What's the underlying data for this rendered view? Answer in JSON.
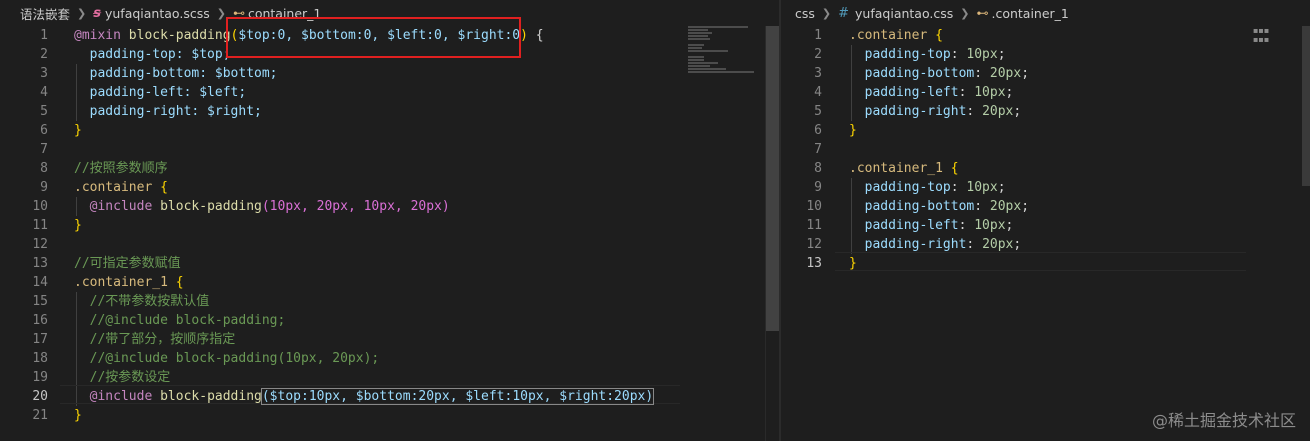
{
  "left": {
    "breadcrumb": {
      "folder": "语法嵌套",
      "file": "yufaqiantao.scss",
      "symbol": "container_1"
    },
    "lines": [
      "1",
      "2",
      "3",
      "4",
      "5",
      "6",
      "7",
      "8",
      "9",
      "10",
      "11",
      "12",
      "13",
      "14",
      "15",
      "16",
      "17",
      "18",
      "19",
      "20",
      "21"
    ],
    "code": {
      "l1_kw": "@mixin",
      "l1_fn": " block-padding",
      "l1_open": "(",
      "l1_args": "$top:0, $bottom:0, $left:0, $right:0",
      "l1_close": ")",
      "l1_brace": " {",
      "l2": "padding-top: $top;",
      "l3": "padding-bottom: $bottom;",
      "l4": "padding-left: $left;",
      "l5": "padding-right: $right;",
      "l6": "}",
      "l8": "//按照参数顺序",
      "l9_sel": ".container",
      "l9_brace": " {",
      "l10_kw": "@include",
      "l10_fn": " block-padding",
      "l10_args": "(10px, 20px, 10px, 20px)",
      "l11": "}",
      "l13": "//可指定参数赋值",
      "l14_sel": ".container_1",
      "l14_brace": " {",
      "l15": "//不带参数按默认值",
      "l16": "//@include block-padding;",
      "l17": "//带了部分，按顺序指定",
      "l18": "//@include block-padding(10px, 20px);",
      "l19": "//按参数设定",
      "l20_kw": "@include",
      "l20_fn": " block-padding",
      "l20_args": "($top:10px, $bottom:20px, $left:10px, $right:20px)",
      "l21": "}"
    }
  },
  "right": {
    "breadcrumb": {
      "folder": "css",
      "file": "yufaqiantao.css",
      "symbol": ".container_1"
    },
    "lines": [
      "1",
      "2",
      "3",
      "4",
      "5",
      "6",
      "7",
      "8",
      "9",
      "10",
      "11",
      "12",
      "13"
    ],
    "code": {
      "r1": ".container",
      "r1b": " {",
      "r2p": "padding-top",
      "r2v": "10px",
      "r3p": "padding-bottom",
      "r3v": "20px",
      "r4p": "padding-left",
      "r4v": "10px",
      "r5p": "padding-right",
      "r5v": "20px",
      "r6": "}",
      "r8": ".container_1",
      "r8b": " {",
      "r9p": "padding-top",
      "r9v": "10px",
      "r10p": "padding-bottom",
      "r10v": "20px",
      "r11p": "padding-left",
      "r11v": "10px",
      "r12p": "padding-right",
      "r12v": "20px",
      "r13": "}"
    }
  },
  "watermark": "@稀土掘金技术社区",
  "active_line_left": "20",
  "active_line_right": "13"
}
